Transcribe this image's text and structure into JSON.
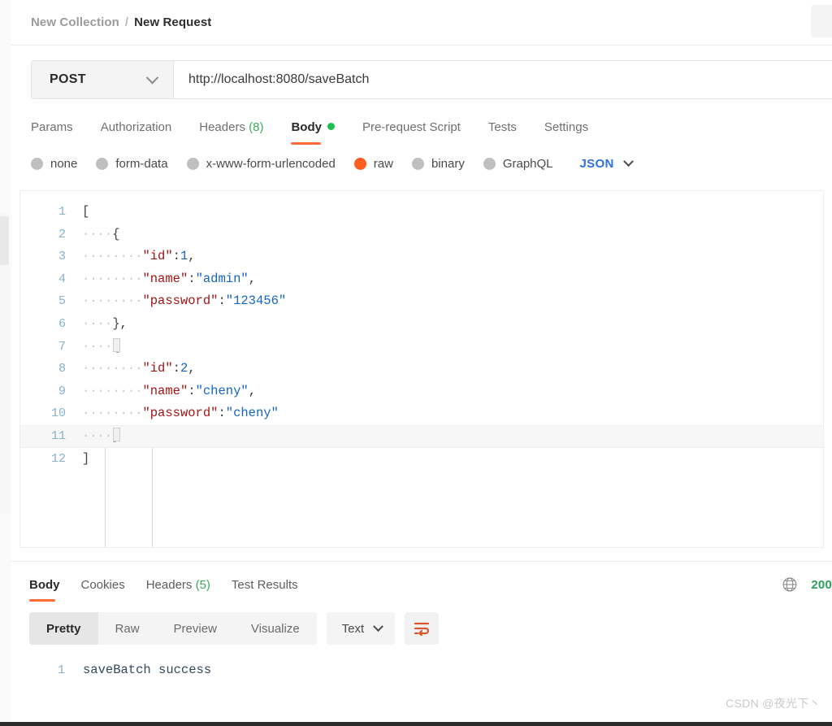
{
  "breadcrumb": {
    "collection": "New Collection",
    "separator": "/",
    "request": "New Request"
  },
  "url_bar": {
    "method": "POST",
    "url": "http://localhost:8080/saveBatch"
  },
  "request_tabs": [
    {
      "label": "Params",
      "active": false
    },
    {
      "label": "Authorization",
      "active": false
    },
    {
      "label": "Headers",
      "count": "(8)",
      "active": false
    },
    {
      "label": "Body",
      "active": true,
      "dot": true
    },
    {
      "label": "Pre-request Script",
      "active": false
    },
    {
      "label": "Tests",
      "active": false
    },
    {
      "label": "Settings",
      "active": false
    }
  ],
  "body_types": [
    {
      "label": "none",
      "selected": false
    },
    {
      "label": "form-data",
      "selected": false
    },
    {
      "label": "x-www-form-urlencoded",
      "selected": false
    },
    {
      "label": "raw",
      "selected": true
    },
    {
      "label": "binary",
      "selected": false
    },
    {
      "label": "GraphQL",
      "selected": false
    }
  ],
  "body_format": {
    "label": "JSON"
  },
  "editor": {
    "lines": [
      {
        "num": "1",
        "open": "["
      },
      {
        "num": "2",
        "indent": "····",
        "open": "{"
      },
      {
        "num": "3",
        "indent": "····",
        "indent2": "····",
        "key": "\"id\"",
        "colon": ":",
        "num_val": "1",
        "tail": ","
      },
      {
        "num": "4",
        "indent": "····",
        "indent2": "····",
        "key": "\"name\"",
        "colon": ":",
        "str_val": "\"admin\"",
        "tail": ","
      },
      {
        "num": "5",
        "indent": "····",
        "indent2": "····",
        "key": "\"password\"",
        "colon": ":",
        "str_val": "\"123456\""
      },
      {
        "num": "6",
        "indent": "····",
        "open": "}",
        "tail": ","
      },
      {
        "num": "7",
        "indent": "····",
        "open": "{"
      },
      {
        "num": "8",
        "indent": "····",
        "indent2": "····",
        "key": "\"id\"",
        "colon": ":",
        "num_val": "2",
        "tail": ","
      },
      {
        "num": "9",
        "indent": "····",
        "indent2": "····",
        "key": "\"name\"",
        "colon": ":",
        "str_val": "\"cheny\"",
        "tail": ","
      },
      {
        "num": "10",
        "indent": "····",
        "indent2": "····",
        "key": "\"password\"",
        "colon": ":",
        "str_val": "\"cheny\""
      },
      {
        "num": "11",
        "indent": "····",
        "open": "}",
        "highlight": true
      },
      {
        "num": "12",
        "open": "]"
      }
    ]
  },
  "response_tabs": [
    {
      "label": "Body",
      "active": true
    },
    {
      "label": "Cookies",
      "active": false
    },
    {
      "label": "Headers",
      "count": "(5)",
      "active": false
    },
    {
      "label": "Test Results",
      "active": false
    }
  ],
  "response_status": {
    "code": "200",
    "globe_icon": "globe-icon"
  },
  "response_format": {
    "views": [
      {
        "label": "Pretty",
        "active": true
      },
      {
        "label": "Raw",
        "active": false
      },
      {
        "label": "Preview",
        "active": false
      },
      {
        "label": "Visualize",
        "active": false
      }
    ],
    "language": "Text",
    "wrap_icon": "word-wrap-icon"
  },
  "response_body": {
    "lines": [
      {
        "num": "1",
        "text": "saveBatch success"
      }
    ]
  },
  "watermark": "CSDN @夜光下丶",
  "colors": {
    "accent": "#ff6c37",
    "success": "#2aa05a",
    "json_blue": "#2f6fe0",
    "string": "#1565c0",
    "key": "#a31515"
  }
}
